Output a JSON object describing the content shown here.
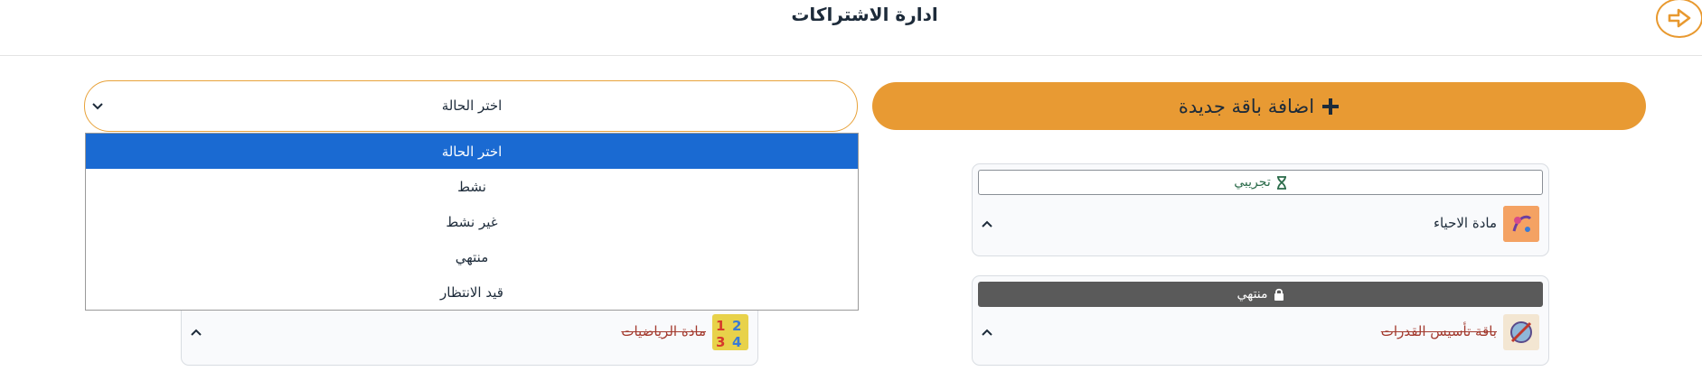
{
  "header": {
    "title": "ادارة الاشتراكات",
    "back_icon": "arrow-right-circle-icon"
  },
  "colors": {
    "accent": "#e89a33",
    "select_highlight": "#1a6ad2",
    "ended_badge": "#5a5a5a",
    "struck_text": "#a33a2e",
    "trial_text": "#2a6b4a"
  },
  "toolbar": {
    "add_label": "اضافة باقة جديدة",
    "add_icon": "plus-icon",
    "status_select": {
      "selected": "اختر الحالة",
      "options": [
        "اختر الحالة",
        "نشط",
        "غير نشط",
        "منتهي",
        "قيد الانتظار"
      ],
      "highlighted_index": 0
    }
  },
  "cards": [
    {
      "name": "مادة الاحياء",
      "badge": "تجريبي",
      "badge_icon": "hourglass-icon",
      "thumb_icon": "biology-icon"
    },
    {
      "name": "باقة تأسيس القدرات",
      "badge": "منتهي",
      "badge_icon": "lock-icon",
      "thumb_icon": "abilities-icon"
    },
    {
      "name": "مادة الرياضيات",
      "thumb_icon": "math-numbers-icon"
    }
  ]
}
